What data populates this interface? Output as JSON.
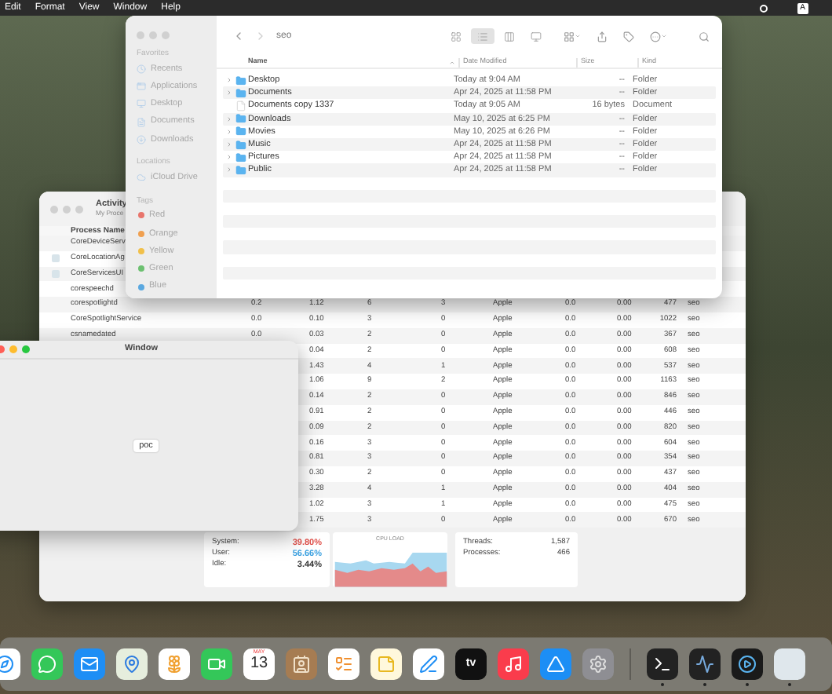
{
  "menu_bar": {
    "items": [
      "Edit",
      "Format",
      "View",
      "Window",
      "Help"
    ],
    "input_source": "A"
  },
  "activity_monitor": {
    "title": "Activity",
    "subtitle": "My Proce",
    "columns": [
      "Process Name"
    ],
    "rows": [
      {
        "name": "CoreDeviceServ",
        "kind": "plain"
      },
      {
        "name": "CoreLocationAg",
        "kind": "app"
      },
      {
        "name": "CoreServicesUI",
        "kind": "app"
      },
      {
        "name": "corespeechd",
        "kind": "plain"
      },
      {
        "name": "corespotlightd",
        "kind": "plain",
        "cells": [
          "0.2",
          "1.12",
          "6",
          "3",
          "Apple",
          "0.0",
          "0.00",
          "477",
          "seo"
        ]
      },
      {
        "name": "CoreSpotlightService",
        "kind": "plain",
        "cells": [
          "0.0",
          "0.10",
          "3",
          "0",
          "Apple",
          "0.0",
          "0.00",
          "1022",
          "seo"
        ]
      },
      {
        "name": "csnamedated",
        "kind": "plain",
        "cells": [
          "0.0",
          "0.03",
          "2",
          "0",
          "Apple",
          "0.0",
          "0.00",
          "367",
          "seo"
        ]
      },
      {
        "kind": "plain",
        "cells": [
          "",
          "0.04",
          "2",
          "0",
          "Apple",
          "0.0",
          "0.00",
          "608",
          "seo"
        ]
      },
      {
        "kind": "plain",
        "cells": [
          "",
          "1.43",
          "4",
          "1",
          "Apple",
          "0.0",
          "0.00",
          "537",
          "seo"
        ]
      },
      {
        "kind": "plain",
        "cells": [
          "",
          "1.06",
          "9",
          "2",
          "Apple",
          "0.0",
          "0.00",
          "1163",
          "seo"
        ]
      },
      {
        "kind": "plain",
        "cells": [
          "",
          "0.14",
          "2",
          "0",
          "Apple",
          "0.0",
          "0.00",
          "846",
          "seo"
        ]
      },
      {
        "kind": "plain",
        "cells": [
          "",
          "0.91",
          "2",
          "0",
          "Apple",
          "0.0",
          "0.00",
          "446",
          "seo"
        ]
      },
      {
        "kind": "plain",
        "cells": [
          "",
          "0.09",
          "2",
          "0",
          "Apple",
          "0.0",
          "0.00",
          "820",
          "seo"
        ]
      },
      {
        "kind": "plain",
        "cells": [
          "",
          "0.16",
          "3",
          "0",
          "Apple",
          "0.0",
          "0.00",
          "604",
          "seo"
        ]
      },
      {
        "kind": "plain",
        "cells": [
          "",
          "0.81",
          "3",
          "0",
          "Apple",
          "0.0",
          "0.00",
          "354",
          "seo"
        ]
      },
      {
        "kind": "plain",
        "cells": [
          "",
          "0.30",
          "2",
          "0",
          "Apple",
          "0.0",
          "0.00",
          "437",
          "seo"
        ]
      },
      {
        "kind": "plain",
        "cells": [
          "",
          "3.28",
          "4",
          "1",
          "Apple",
          "0.0",
          "0.00",
          "404",
          "seo"
        ]
      },
      {
        "kind": "plain",
        "cells": [
          "",
          "1.02",
          "3",
          "1",
          "Apple",
          "0.0",
          "0.00",
          "475",
          "seo"
        ]
      },
      {
        "kind": "plain",
        "cells": [
          "",
          "1.75",
          "3",
          "0",
          "Apple",
          "0.0",
          "0.00",
          "670",
          "seo"
        ]
      }
    ],
    "cpu_stats": [
      {
        "label": "System:",
        "value": "39.80%",
        "color": "#e0504a"
      },
      {
        "label": "User:",
        "value": "56.66%",
        "color": "#3aa0e0"
      },
      {
        "label": "Idle:",
        "value": "3.44%",
        "color": "#333333"
      }
    ],
    "cpu_load_title": "CPU LOAD",
    "counts": [
      {
        "label": "Threads:",
        "value": "1,587"
      },
      {
        "label": "Processes:",
        "value": "466"
      }
    ]
  },
  "finder": {
    "path": "seo",
    "view_modes": [
      {
        "kind": "icons",
        "selected": false
      },
      {
        "kind": "list",
        "selected": true
      },
      {
        "kind": "columns",
        "selected": false
      },
      {
        "kind": "gallery",
        "selected": false
      }
    ],
    "sidebar": [
      {
        "heading": "Favorites",
        "items": [
          {
            "label": "Recents",
            "kind": "clock"
          },
          {
            "label": "Applications",
            "kind": "apps"
          },
          {
            "label": "Desktop",
            "kind": "desktop"
          },
          {
            "label": "Documents",
            "kind": "document"
          },
          {
            "label": "Downloads",
            "kind": "download"
          }
        ]
      },
      {
        "heading": "Locations",
        "items": [
          {
            "label": "iCloud Drive",
            "kind": "cloud"
          }
        ]
      },
      {
        "heading": "Tags",
        "items": [
          {
            "label": "Red",
            "kind": "tag",
            "color": "#e8756c"
          },
          {
            "label": "Orange",
            "kind": "tag",
            "color": "#f0a050"
          },
          {
            "label": "Yellow",
            "kind": "tag",
            "color": "#f1c04a"
          },
          {
            "label": "Green",
            "kind": "tag",
            "color": "#6cc070"
          },
          {
            "label": "Blue",
            "kind": "tag",
            "color": "#5aa8e0"
          }
        ]
      }
    ],
    "columns": [
      "Name",
      "Date Modified",
      "Size",
      "Kind"
    ],
    "files": [
      {
        "name": "Desktop",
        "date": "Today at 9:04 AM",
        "size": "--",
        "kind_text": "Folder",
        "kind": "folder"
      },
      {
        "name": "Documents",
        "date": "Apr 24, 2025 at 11:58 PM",
        "size": "--",
        "kind_text": "Folder",
        "kind": "folder"
      },
      {
        "name": "Documents copy 1337",
        "date": "Today at 9:05 AM",
        "size": "16 bytes",
        "kind_text": "Document",
        "kind": "document"
      },
      {
        "name": "Downloads",
        "date": "May 10, 2025 at 6:25 PM",
        "size": "--",
        "kind_text": "Folder",
        "kind": "folder"
      },
      {
        "name": "Movies",
        "date": "May 10, 2025 at 6:26 PM",
        "size": "--",
        "kind_text": "Folder",
        "kind": "folder"
      },
      {
        "name": "Music",
        "date": "Apr 24, 2025 at 11:58 PM",
        "size": "--",
        "kind_text": "Folder",
        "kind": "folder"
      },
      {
        "name": "Pictures",
        "date": "Apr 24, 2025 at 11:58 PM",
        "size": "--",
        "kind_text": "Folder",
        "kind": "folder"
      },
      {
        "name": "Public",
        "date": "Apr 24, 2025 at 11:58 PM",
        "size": "--",
        "kind_text": "Folder",
        "kind": "folder"
      }
    ]
  },
  "small_window": {
    "title": "Window",
    "button": "poc"
  },
  "dock": [
    {
      "kind": "safari"
    },
    {
      "kind": "messages"
    },
    {
      "kind": "mail"
    },
    {
      "kind": "maps"
    },
    {
      "kind": "photos"
    },
    {
      "kind": "facetime"
    },
    {
      "kind": "calendar",
      "month": "MAY",
      "day": "13"
    },
    {
      "kind": "contacts"
    },
    {
      "kind": "reminders"
    },
    {
      "kind": "notes"
    },
    {
      "kind": "freeform"
    },
    {
      "kind": "tv",
      "label": "tv"
    },
    {
      "kind": "music"
    },
    {
      "kind": "appstore"
    },
    {
      "kind": "settings"
    },
    {
      "kind": "separator"
    },
    {
      "kind": "terminal",
      "running": true
    },
    {
      "kind": "activity",
      "running": true
    },
    {
      "kind": "quicktime",
      "running": true
    },
    {
      "kind": "blank",
      "running": true
    }
  ]
}
